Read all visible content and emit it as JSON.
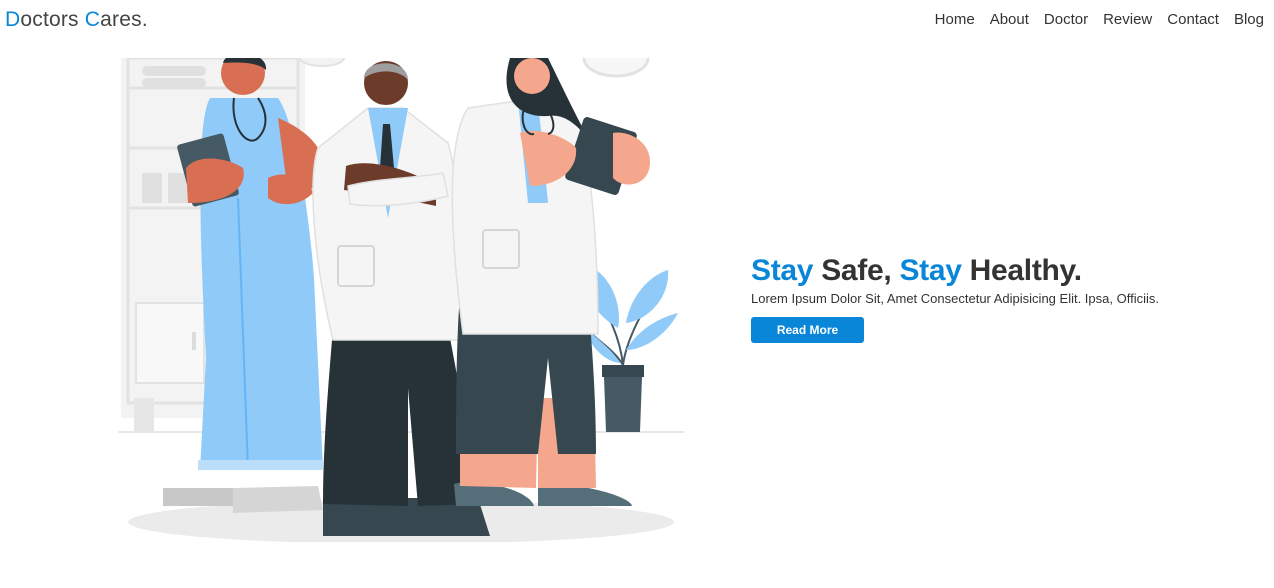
{
  "brand": {
    "logo_letter_1": "D",
    "logo_part_1": "octors ",
    "logo_letter_2": "C",
    "logo_part_2": "ares."
  },
  "nav": {
    "items": [
      {
        "label": "Home"
      },
      {
        "label": "About"
      },
      {
        "label": "Doctor"
      },
      {
        "label": "Review"
      },
      {
        "label": "Contact"
      },
      {
        "label": "Blog"
      }
    ]
  },
  "hero": {
    "title_word_1": "Stay",
    "title_part_1": " Safe, ",
    "title_word_2": "Stay",
    "title_part_2": " Healthy.",
    "subtitle": "Lorem Ipsum Dolor Sit, Amet Consectetur Adipisicing Elit. Ipsa, Officiis.",
    "button_label": "Read More"
  },
  "colors": {
    "accent": "#0a86d8",
    "text": "#333333"
  }
}
